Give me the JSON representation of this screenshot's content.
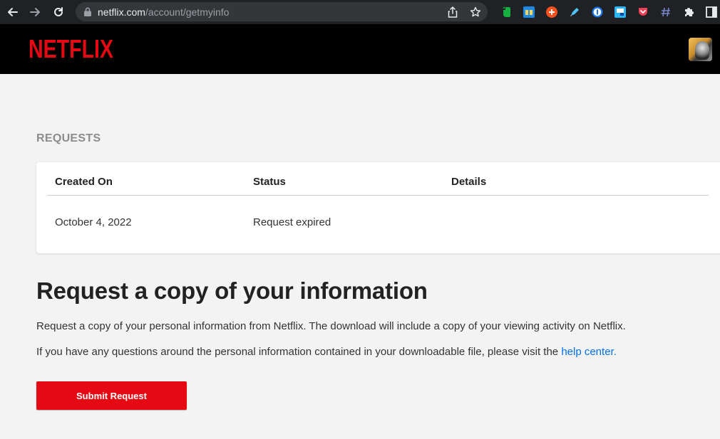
{
  "browser": {
    "url_domain": "netflix.com",
    "url_path": "/account/getmyinfo"
  },
  "header": {
    "logo_text": "NETFLIX",
    "brand_color": "#e50914"
  },
  "requests": {
    "section_label": "REQUESTS",
    "columns": [
      "Created On",
      "Status",
      "Details"
    ],
    "rows": [
      {
        "created_on": "October 4, 2022",
        "status": "Request expired",
        "details": ""
      }
    ]
  },
  "info": {
    "title": "Request a copy of your information",
    "description": "Request a copy of your personal information from Netflix. The download will include a copy of your viewing activity on Netflix.",
    "questions_text": "If you have any questions around the personal information contained in your downloadable file, please visit the ",
    "help_link": "help center.",
    "submit_label": "Submit Request"
  },
  "colors": {
    "link": "#0071eb",
    "page_bg": "#f3f3f3"
  }
}
